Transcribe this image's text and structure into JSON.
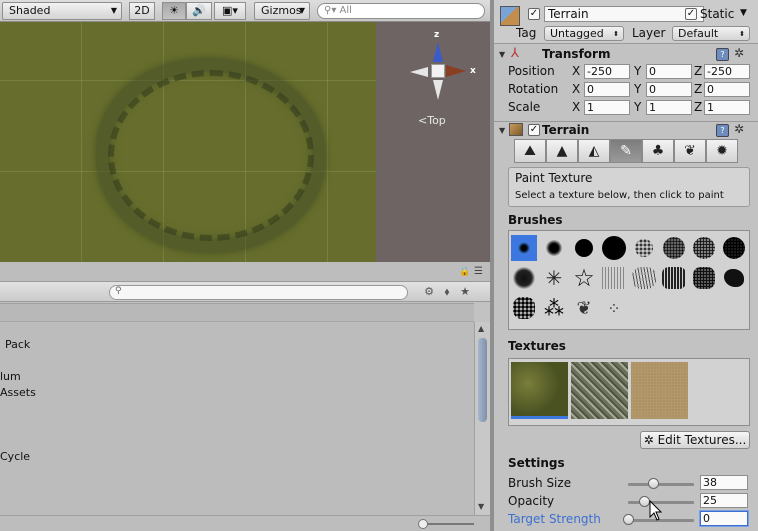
{
  "scene": {
    "toolbar": {
      "render_mode": "Shaded",
      "twod": "2D",
      "sun_icon": "sun-icon",
      "audio_icon": "speaker-icon",
      "fx_icon": "image-icon",
      "gizmos": "Gizmos",
      "search_placeholder": "All"
    },
    "gizmo": {
      "z": "z",
      "x": "x",
      "view_label": "Top"
    }
  },
  "project": {
    "items": [
      "Pack",
      "lum",
      "Assets",
      "Cycle"
    ]
  },
  "inspector": {
    "object_name": "Terrain",
    "static_label": "Static",
    "tag_label": "Tag",
    "tag_value": "Untagged",
    "layer_label": "Layer",
    "layer_value": "Default",
    "transform": {
      "title": "Transform",
      "rows": [
        {
          "label": "Position",
          "x": "-250",
          "y": "0",
          "z": "-250"
        },
        {
          "label": "Rotation",
          "x": "0",
          "y": "0",
          "z": "0"
        },
        {
          "label": "Scale",
          "x": "1",
          "y": "1",
          "z": "1"
        }
      ],
      "axes": [
        "X",
        "Y",
        "Z"
      ]
    },
    "terrain": {
      "title": "Terrain",
      "tools": [
        "raise-lower-icon",
        "paint-height-icon",
        "smooth-height-icon",
        "paint-texture-icon",
        "place-trees-icon",
        "paint-details-icon",
        "settings-icon"
      ],
      "info_title": "Paint Texture",
      "info_sub": "Select a texture below, then click to paint",
      "brushes_title": "Brushes",
      "textures_title": "Textures",
      "edit_textures": "Edit Textures...",
      "settings_title": "Settings",
      "settings": [
        {
          "label": "Brush Size",
          "value": "38",
          "fraction": 0.38
        },
        {
          "label": "Opacity",
          "value": "25",
          "fraction": 0.25
        },
        {
          "label": "Target Strength",
          "value": "0",
          "fraction": 0.0
        }
      ]
    }
  },
  "colors": {
    "accent": "#3c78e0",
    "terrain_green": "#676e2d",
    "target_strength_label": "#3b6fcf"
  }
}
